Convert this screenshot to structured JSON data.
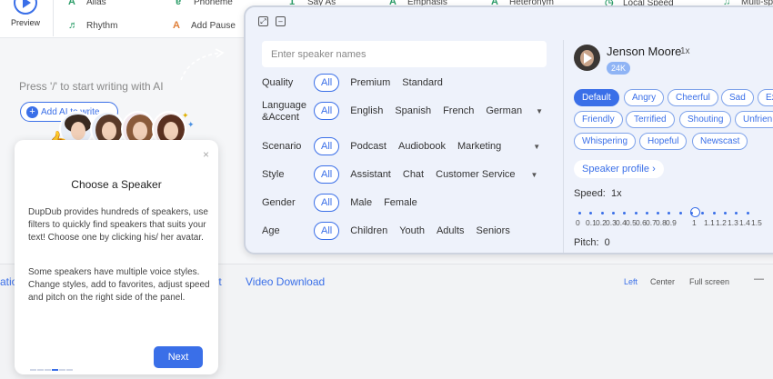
{
  "toolbar": {
    "preview_label": "Preview",
    "items_row1": [
      "Alias",
      "Phoneme",
      "Say As",
      "Emphasis",
      "Heteronym",
      "Local Speed",
      "Multi-speak"
    ],
    "items_row2": [
      "Rhythm",
      "Add Pause"
    ]
  },
  "editor": {
    "hint": "Press '/' to start writing with AI",
    "add_ai_label": "Add AI to write"
  },
  "bottombar": {
    "tabs": [
      "ation",
      "ent",
      "Video Download"
    ],
    "options": [
      "Left",
      "Center",
      "Full screen"
    ],
    "dash": "—"
  },
  "panel": {
    "search_placeholder": "Enter speaker names",
    "filters": [
      {
        "label": "Quality",
        "all": "All",
        "options": [
          "Premium",
          "Standard"
        ],
        "dropdown": false
      },
      {
        "label": "Language &Accent",
        "all": "All",
        "options": [
          "English",
          "Spanish",
          "French",
          "German"
        ],
        "dropdown": true
      },
      {
        "label": "Scenario",
        "all": "All",
        "options": [
          "Podcast",
          "Audiobook",
          "Marketing"
        ],
        "dropdown": true
      },
      {
        "label": "Style",
        "all": "All",
        "options": [
          "Assistant",
          "Chat",
          "Customer Service"
        ],
        "dropdown": true
      },
      {
        "label": "Gender",
        "all": "All",
        "options": [
          "Male",
          "Female"
        ],
        "dropdown": false
      },
      {
        "label": "Age",
        "all": "All",
        "options": [
          "Children",
          "Youth",
          "Adults",
          "Seniors"
        ],
        "dropdown": false
      }
    ],
    "speaker": {
      "name": "Jenson Moore",
      "speed": "1x",
      "badge": "24K"
    },
    "styles": [
      "Default",
      "Angry",
      "Cheerful",
      "Sad",
      "Ex",
      "Friendly",
      "Terrified",
      "Shouting",
      "Unfrien",
      "Whispering",
      "Hopeful",
      "Newscast"
    ],
    "active_style": "Default",
    "profile_label": "Speaker profile",
    "speed_label": "Speed:",
    "speed_value": "1x",
    "speed_scale": [
      "0",
      "0.1",
      "0.2",
      "0.3",
      "0.4",
      "0.5",
      "0.6",
      "0.7",
      "0.8",
      "0.9",
      "1",
      "1.1",
      "1.2",
      "1.3",
      "1.4",
      "1.5"
    ],
    "pitch_label": "Pitch:",
    "pitch_value": "0"
  },
  "card": {
    "close": "×",
    "title": "Choose a Speaker",
    "paragraph1": "DupDub provides hundreds of speakers, use filters to quickly find speakers that suits your text! Choose one by clicking his/ her avatar.",
    "paragraph2": "Some speakers have multiple voice styles. Change styles, add to favorites, adjust speed and pitch on the right side of the panel.",
    "next_label": "Next",
    "steps_total": 6,
    "step_current": 4
  },
  "colors": {
    "accent": "#3a6fe8",
    "panel_bg": "#eef2fb",
    "badge": "#8fb4f5"
  }
}
